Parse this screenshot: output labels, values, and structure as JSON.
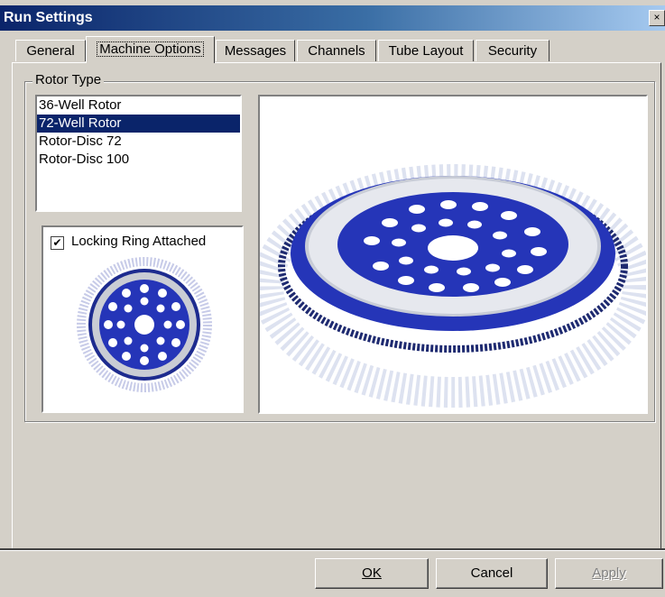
{
  "window": {
    "title": "Run Settings",
    "close_glyph": "×"
  },
  "tabs": [
    "General",
    "Machine Options",
    "Messages",
    "Channels",
    "Tube Layout",
    "Security"
  ],
  "active_tab": "Machine Options",
  "rotor_group": {
    "legend": "Rotor Type",
    "items": [
      "36-Well Rotor",
      "72-Well Rotor",
      "Rotor-Disc 72",
      "Rotor-Disc 100"
    ],
    "selected_index": 1,
    "locking_ring_label": "Locking Ring Attached",
    "locking_ring_checked": true,
    "checkmark": "✔"
  },
  "buttons": {
    "ok": "OK",
    "cancel": "Cancel",
    "apply": "Apply"
  },
  "colors": {
    "title_bar": "#0a246a",
    "selection": "#0a246a",
    "rotor_blue": "#2535b8",
    "face": "#d4d0c8"
  }
}
